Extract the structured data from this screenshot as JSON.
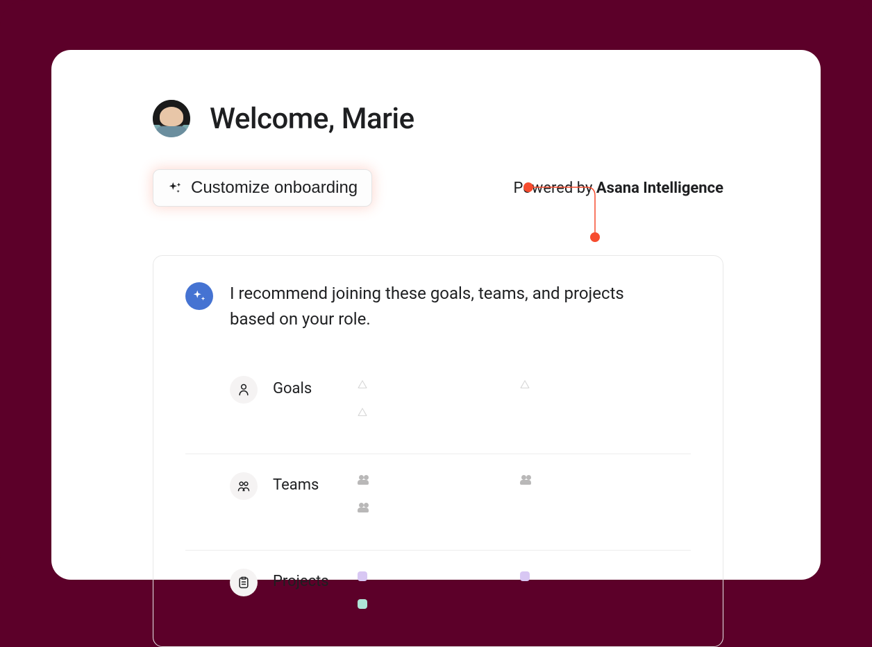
{
  "header": {
    "welcome": "Welcome, Marie"
  },
  "customize": {
    "label": "Customize onboarding"
  },
  "powered_by": {
    "prefix": "Powered by ",
    "brand": "Asana Intelligence"
  },
  "recommendation": {
    "text": "I recommend joining these goals, teams, and projects based on your role."
  },
  "sections": {
    "goals": {
      "label": "Goals"
    },
    "teams": {
      "label": "Teams"
    },
    "projects": {
      "label": "Projects"
    }
  },
  "colors": {
    "accent": "#f64c2f",
    "blue": "#4573d2",
    "bg": "#5c0029"
  }
}
